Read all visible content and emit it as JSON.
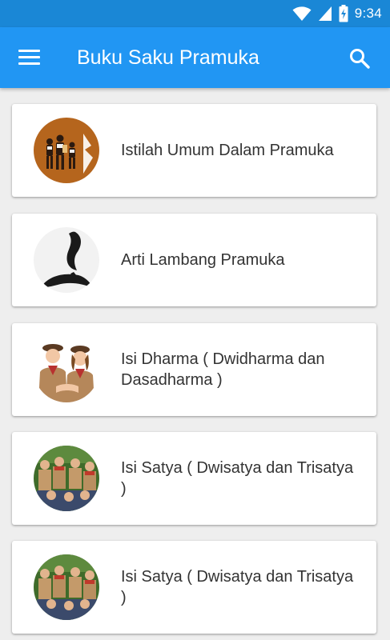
{
  "status_bar": {
    "time": "9:34",
    "icons": [
      "wifi-icon",
      "cellular-signal-icon",
      "battery-charging-icon"
    ],
    "color": "#1a87d6"
  },
  "app_bar": {
    "title": "Buku Saku Pramuka",
    "menu_icon": "hamburger-menu-icon",
    "search_icon": "search-icon",
    "color": "#2196f3"
  },
  "items": [
    {
      "label": "Istilah Umum Dalam Pramuka",
      "image": "scouts-group-illustration"
    },
    {
      "label": "Arti Lambang Pramuka",
      "image": "tunas-kelapa-emblem"
    },
    {
      "label": "Isi Dharma ( Dwidharma dan Dasadharma )",
      "image": "boy-and-girl-scouts-photo"
    },
    {
      "label": "Isi Satya ( Dwisatya dan Trisatya )",
      "image": "scouts-saluting-photo"
    },
    {
      "label": "Isi Satya ( Dwisatya dan Trisatya )",
      "image": "scouts-saluting-photo"
    }
  ]
}
